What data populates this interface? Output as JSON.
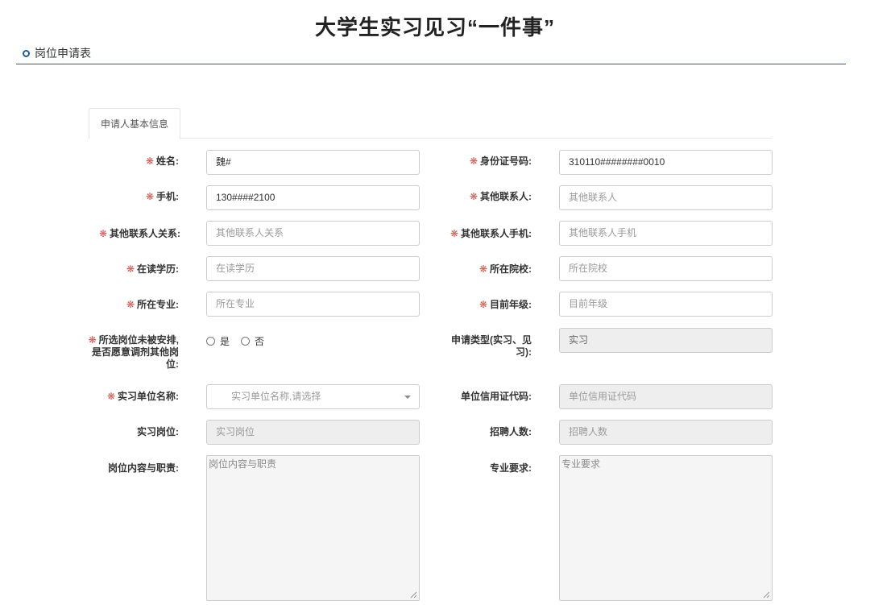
{
  "page": {
    "title": "大学生实习见习“一件事”"
  },
  "section": {
    "title": "岗位申请表"
  },
  "tabs": [
    {
      "label": "申请人基本信息"
    }
  ],
  "colors": {
    "accent": "#1f5f9a",
    "required": "#d9534f"
  },
  "form": {
    "name": {
      "label": "姓名:",
      "value": "魏#"
    },
    "id_number": {
      "label": "身份证号码:",
      "value": "310110########0010"
    },
    "phone": {
      "label": "手机:",
      "value": "130####2100"
    },
    "other_contact": {
      "label": "其他联系人:",
      "placeholder": "其他联系人"
    },
    "other_contact_relation": {
      "label": "其他联系人关系:",
      "placeholder": "其他联系人关系"
    },
    "other_contact_phone": {
      "label": "其他联系人手机:",
      "placeholder": "其他联系人手机"
    },
    "education": {
      "label": "在读学历:",
      "placeholder": "在读学历"
    },
    "school": {
      "label": "所在院校:",
      "placeholder": "所在院校"
    },
    "major": {
      "label": "所在专业:",
      "placeholder": "所在专业"
    },
    "grade": {
      "label": "目前年级:",
      "placeholder": "目前年级"
    },
    "accept_other": {
      "label": "所选岗位未被安排,是否愿意调剂其他岗位:",
      "options": [
        "是",
        "否"
      ]
    },
    "apply_type": {
      "label": "申请类型(实习、见习):",
      "value": "实习"
    },
    "company_name": {
      "label": "实习单位名称:",
      "placeholder": "实习单位名称,请选择"
    },
    "credit_code": {
      "label": "单位信用证代码:",
      "placeholder": "单位信用证代码"
    },
    "position": {
      "label": "实习岗位:",
      "placeholder": "实习岗位"
    },
    "headcount": {
      "label": "招聘人数:",
      "placeholder": "招聘人数"
    },
    "duties": {
      "label": "岗位内容与职责:",
      "placeholder": "岗位内容与职责"
    },
    "requirements": {
      "label": "专业要求:",
      "placeholder": "专业要求"
    }
  }
}
